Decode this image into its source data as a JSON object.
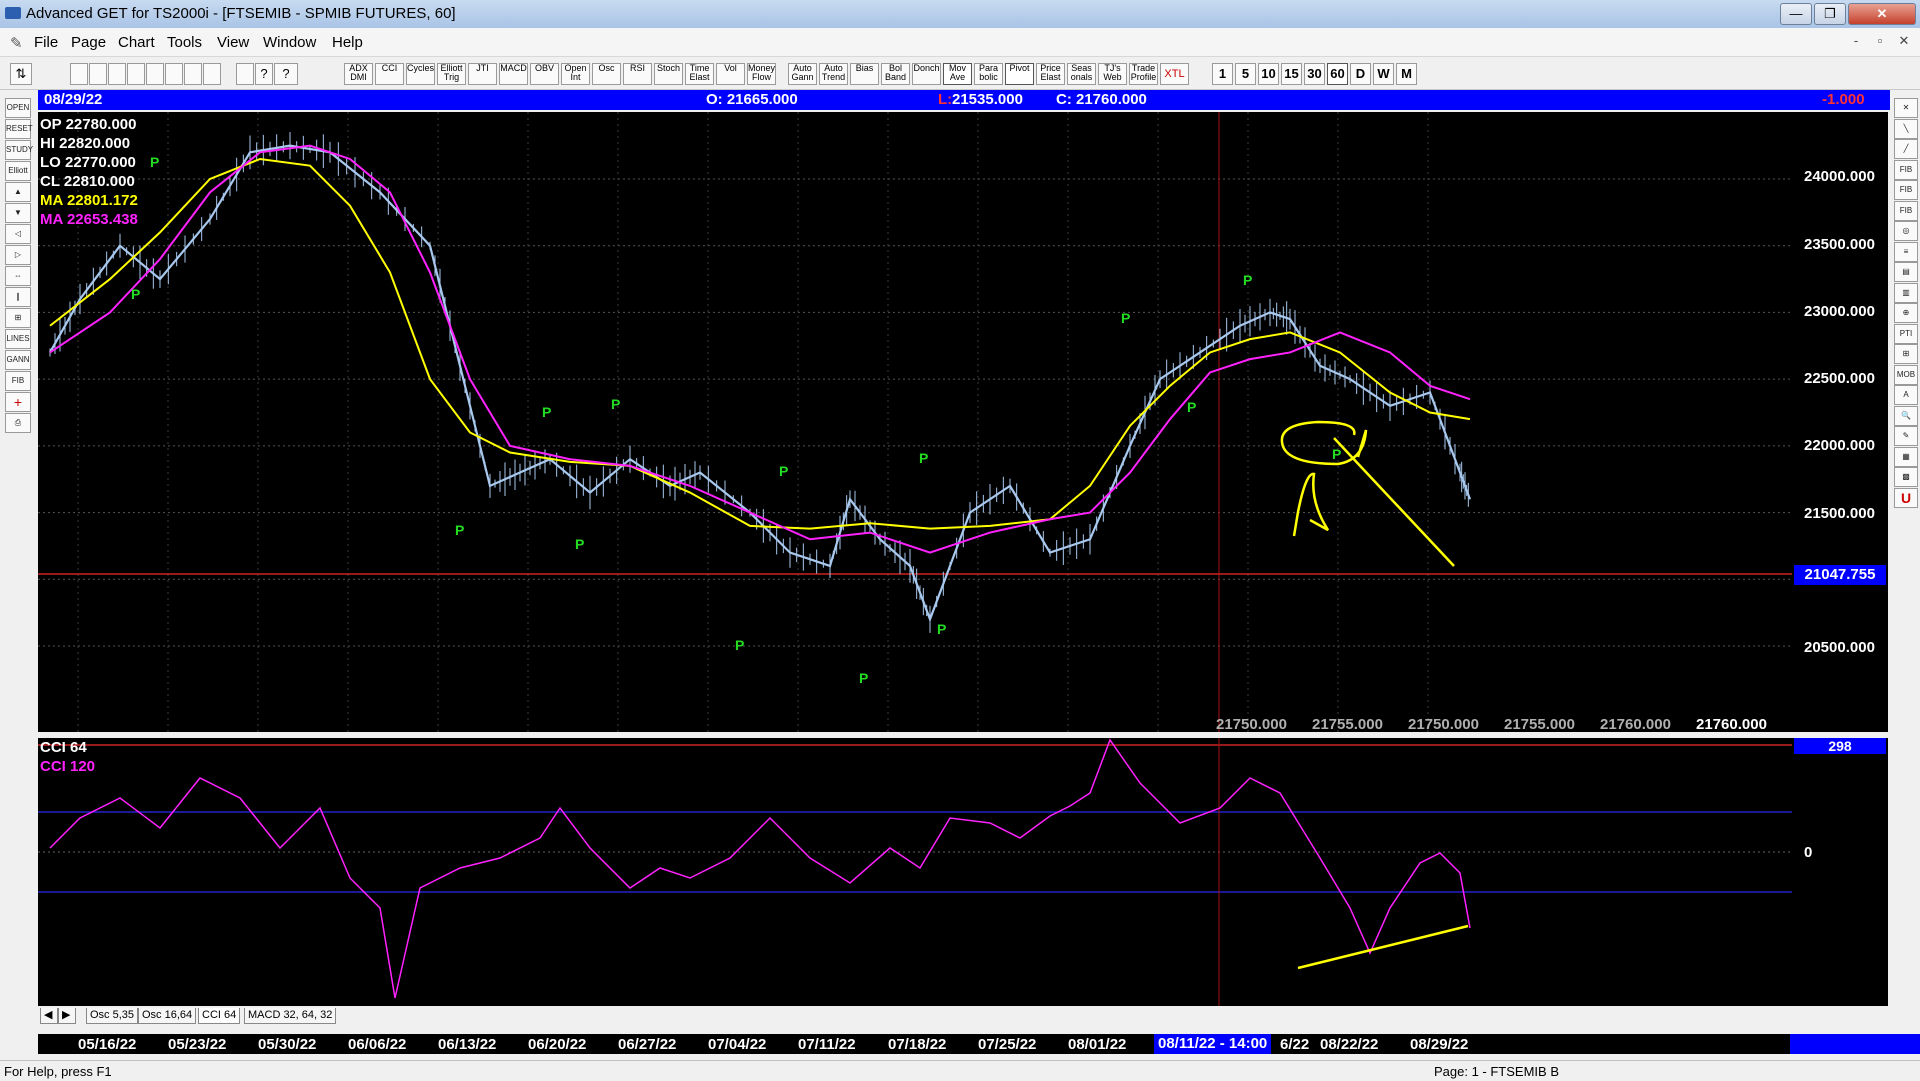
{
  "window": {
    "title": "Advanced GET for TS2000i - [FTSEMIB - SPMIB FUTURES, 60]",
    "minimize_label": "—",
    "maximize_label": "❐",
    "close_label": "✕"
  },
  "menu": {
    "items": [
      "File",
      "Page",
      "Chart",
      "Tools",
      "View",
      "Window",
      "Help"
    ],
    "mdi_buttons": [
      "-",
      "▫",
      "✕"
    ]
  },
  "toolbar": {
    "study_buttons": [
      "ADX DMI",
      "CCI",
      "Cycles",
      "Elliott Trig",
      "JTI",
      "MACD",
      "OBV",
      "Open Int",
      "Osc",
      "RSI",
      "Stoch",
      "Time Elast",
      "Vol",
      "Money Flow",
      "Auto Gann",
      "Auto Trend",
      "Bias",
      "Bol Band",
      "Donch",
      "Mov Ave",
      "Para bolic",
      "Pivot",
      "Price Elast",
      "Seas onals",
      "TJ's Web",
      "Trade Profile",
      "XTL"
    ],
    "interval_buttons": [
      "1",
      "5",
      "10",
      "15",
      "30",
      "60",
      "D",
      "W",
      "M"
    ],
    "active_interval": "60"
  },
  "left_tools": [
    "OPEN",
    "RESET",
    "STUDY",
    "Elliott",
    "▲",
    "▼",
    "◁",
    "▷",
    "⇔",
    "∥",
    "⊞",
    "LINES",
    "GANN",
    "FIB",
    "+",
    "⎙"
  ],
  "right_tools": [
    "✕",
    "╲",
    "╱",
    "FIB RET",
    "FIB EXT",
    "FIB TIME",
    "◎",
    "≡",
    "▤",
    "▥",
    "⊕",
    "PTI",
    "⊞",
    "MOB",
    "A",
    "🔍",
    "✎",
    "▦",
    "▩",
    "U"
  ],
  "infobar": {
    "date": "08/29/22",
    "open": "O: 21665.000",
    "low_prefix": "L:",
    "low": " 21535.000",
    "close": "C: 21760.000",
    "change": "-1.000"
  },
  "ohlc": {
    "op": "OP  22780.000",
    "hi": "HI   22820.000",
    "lo": "LO  22770.000",
    "cl": "CL  22810.000",
    "ma1": "MA  22801.172",
    "ma2": "MA  22653.438"
  },
  "price_scale": [
    "24000.000",
    "23500.000",
    "23000.000",
    "22500.000",
    "22000.000",
    "21500.000",
    "20500.000"
  ],
  "current_price": "21047.755",
  "pivot_values": [
    "21750.000",
    "21755.000",
    "21750.000",
    "21755.000",
    "21760.000",
    "21760.000"
  ],
  "pivot_marker": "P",
  "cci": {
    "label1": "CCI 64",
    "label2": "CCI  120",
    "badge": "298",
    "zero_label": "0"
  },
  "tabs": [
    "Osc 5,35",
    "Osc 16,64",
    "CCI 64",
    "MACD 32, 64, 32"
  ],
  "active_tab": "CCI 64",
  "dates": [
    "05/16/22",
    "05/23/22",
    "05/30/22",
    "06/06/22",
    "06/13/22",
    "06/20/22",
    "06/27/22",
    "07/04/22",
    "07/11/22",
    "07/18/22",
    "07/25/22",
    "08/01/22",
    "6/22",
    "08/22/22",
    "08/29/22"
  ],
  "date_cursor": "08/11/22 - 14:00",
  "status": {
    "help": "For Help, press F1",
    "page": "Page: 1 - FTSEMIB B"
  },
  "colors": {
    "ma_fast": "#ffff00",
    "ma_slow": "#ff22ff",
    "bars": "#a8c8ee",
    "pivot": "#22dd22",
    "cursor": "#0000ff"
  }
}
